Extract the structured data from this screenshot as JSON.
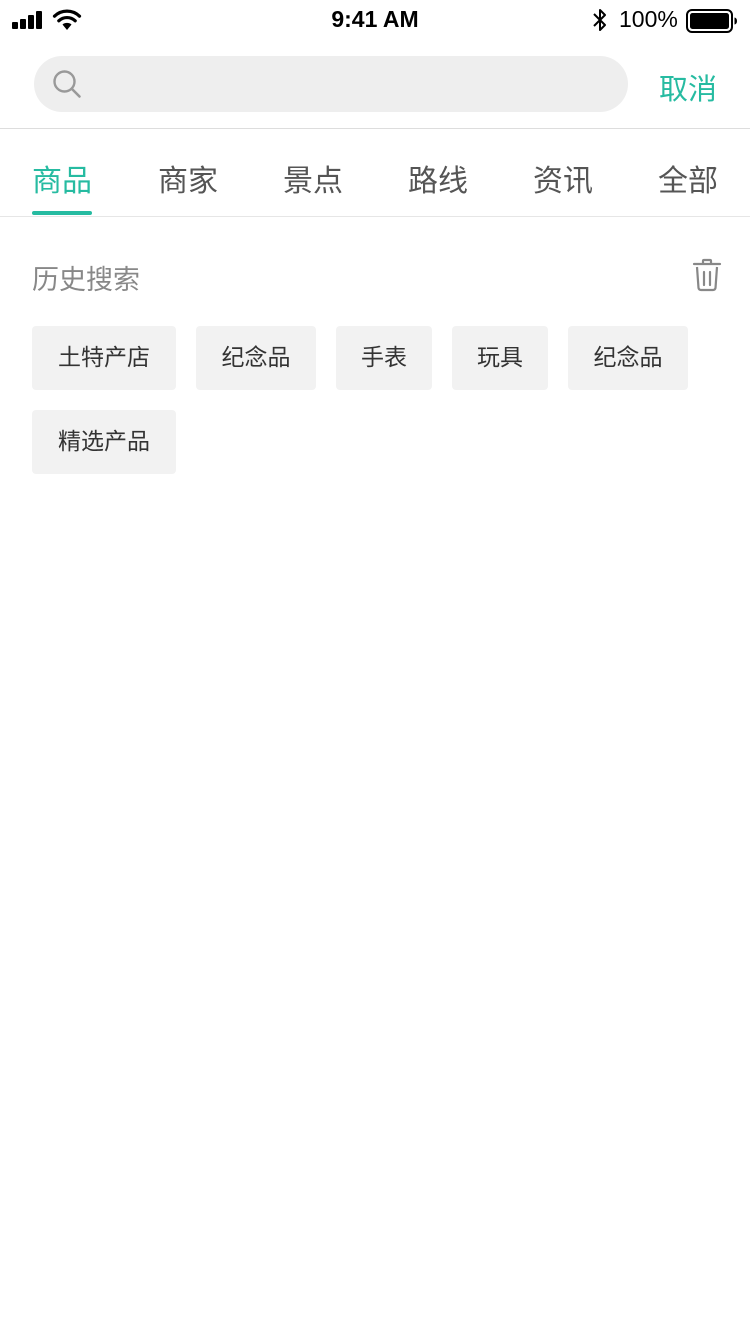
{
  "status_bar": {
    "time": "9:41 AM",
    "battery_percent": "100%",
    "icons": [
      "signal-icon",
      "wifi-icon",
      "bluetooth-icon",
      "battery-icon"
    ]
  },
  "search": {
    "placeholder": "",
    "value": "",
    "cancel_label": "取消"
  },
  "tabs": [
    {
      "label": "商品",
      "active": true
    },
    {
      "label": "商家",
      "active": false
    },
    {
      "label": "景点",
      "active": false
    },
    {
      "label": "路线",
      "active": false
    },
    {
      "label": "资讯",
      "active": false
    },
    {
      "label": "全部",
      "active": false
    }
  ],
  "history": {
    "title": "历史搜索",
    "tags": [
      "土特产店",
      "纪念品",
      "手表",
      "玩具",
      "纪念品",
      "精选产品"
    ]
  },
  "colors": {
    "accent": "#26bba1",
    "tag_bg": "#f2f2f2",
    "search_bg": "#eeeeee"
  }
}
